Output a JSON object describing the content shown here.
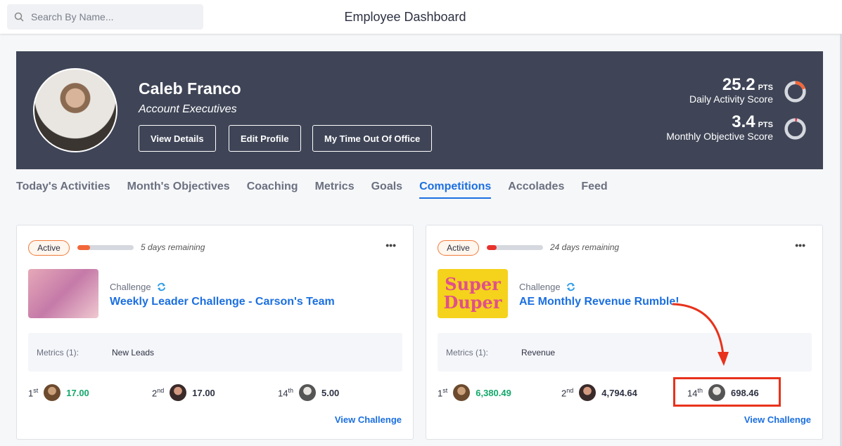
{
  "topbar": {
    "search_placeholder": "Search By Name...",
    "title": "Employee Dashboard"
  },
  "profile": {
    "name": "Caleb Franco",
    "role": "Account Executives",
    "buttons": [
      "View Details",
      "Edit Profile",
      "My Time Out Of Office"
    ],
    "scores": [
      {
        "value": "25.2",
        "unit": "PTS",
        "label": "Daily Activity Score",
        "fraction": 0.2,
        "color": "#f2673a"
      },
      {
        "value": "3.4",
        "unit": "PTS",
        "label": "Monthly Objective Score",
        "fraction": 0.03,
        "color": "#e8324a"
      }
    ]
  },
  "tabs": [
    {
      "label": "Today's Activities"
    },
    {
      "label": "Month's Objectives"
    },
    {
      "label": "Coaching"
    },
    {
      "label": "Metrics"
    },
    {
      "label": "Goals"
    },
    {
      "label": "Competitions",
      "active": true
    },
    {
      "label": "Accolades"
    },
    {
      "label": "Feed"
    }
  ],
  "cards": [
    {
      "status": "Active",
      "progress": 0.22,
      "progress_color": "#f2673a",
      "remaining": "5 days remaining",
      "more": "•••",
      "type": "Challenge",
      "title": "Weekly Leader Challenge - Carson's Team",
      "metrics_label": "Metrics (1):",
      "metric": "New Leads",
      "ranks": [
        {
          "pos": "1",
          "suffix": "st",
          "value": "17.00"
        },
        {
          "pos": "2",
          "suffix": "nd",
          "value": "17.00"
        },
        {
          "pos": "14",
          "suffix": "th",
          "value": "5.00"
        }
      ],
      "view": "View Challenge"
    },
    {
      "status": "Active",
      "progress": 0.17,
      "progress_color": "#e8322c",
      "remaining": "24 days remaining",
      "more": "•••",
      "type": "Challenge",
      "title": "AE Monthly Revenue Rumble!",
      "thumb_text": "Super Duper",
      "metrics_label": "Metrics (1):",
      "metric": "Revenue",
      "ranks": [
        {
          "pos": "1",
          "suffix": "st",
          "value": "6,380.49"
        },
        {
          "pos": "2",
          "suffix": "nd",
          "value": "4,794.64"
        },
        {
          "pos": "14",
          "suffix": "th",
          "value": "698.46"
        }
      ],
      "view": "View Challenge"
    }
  ]
}
